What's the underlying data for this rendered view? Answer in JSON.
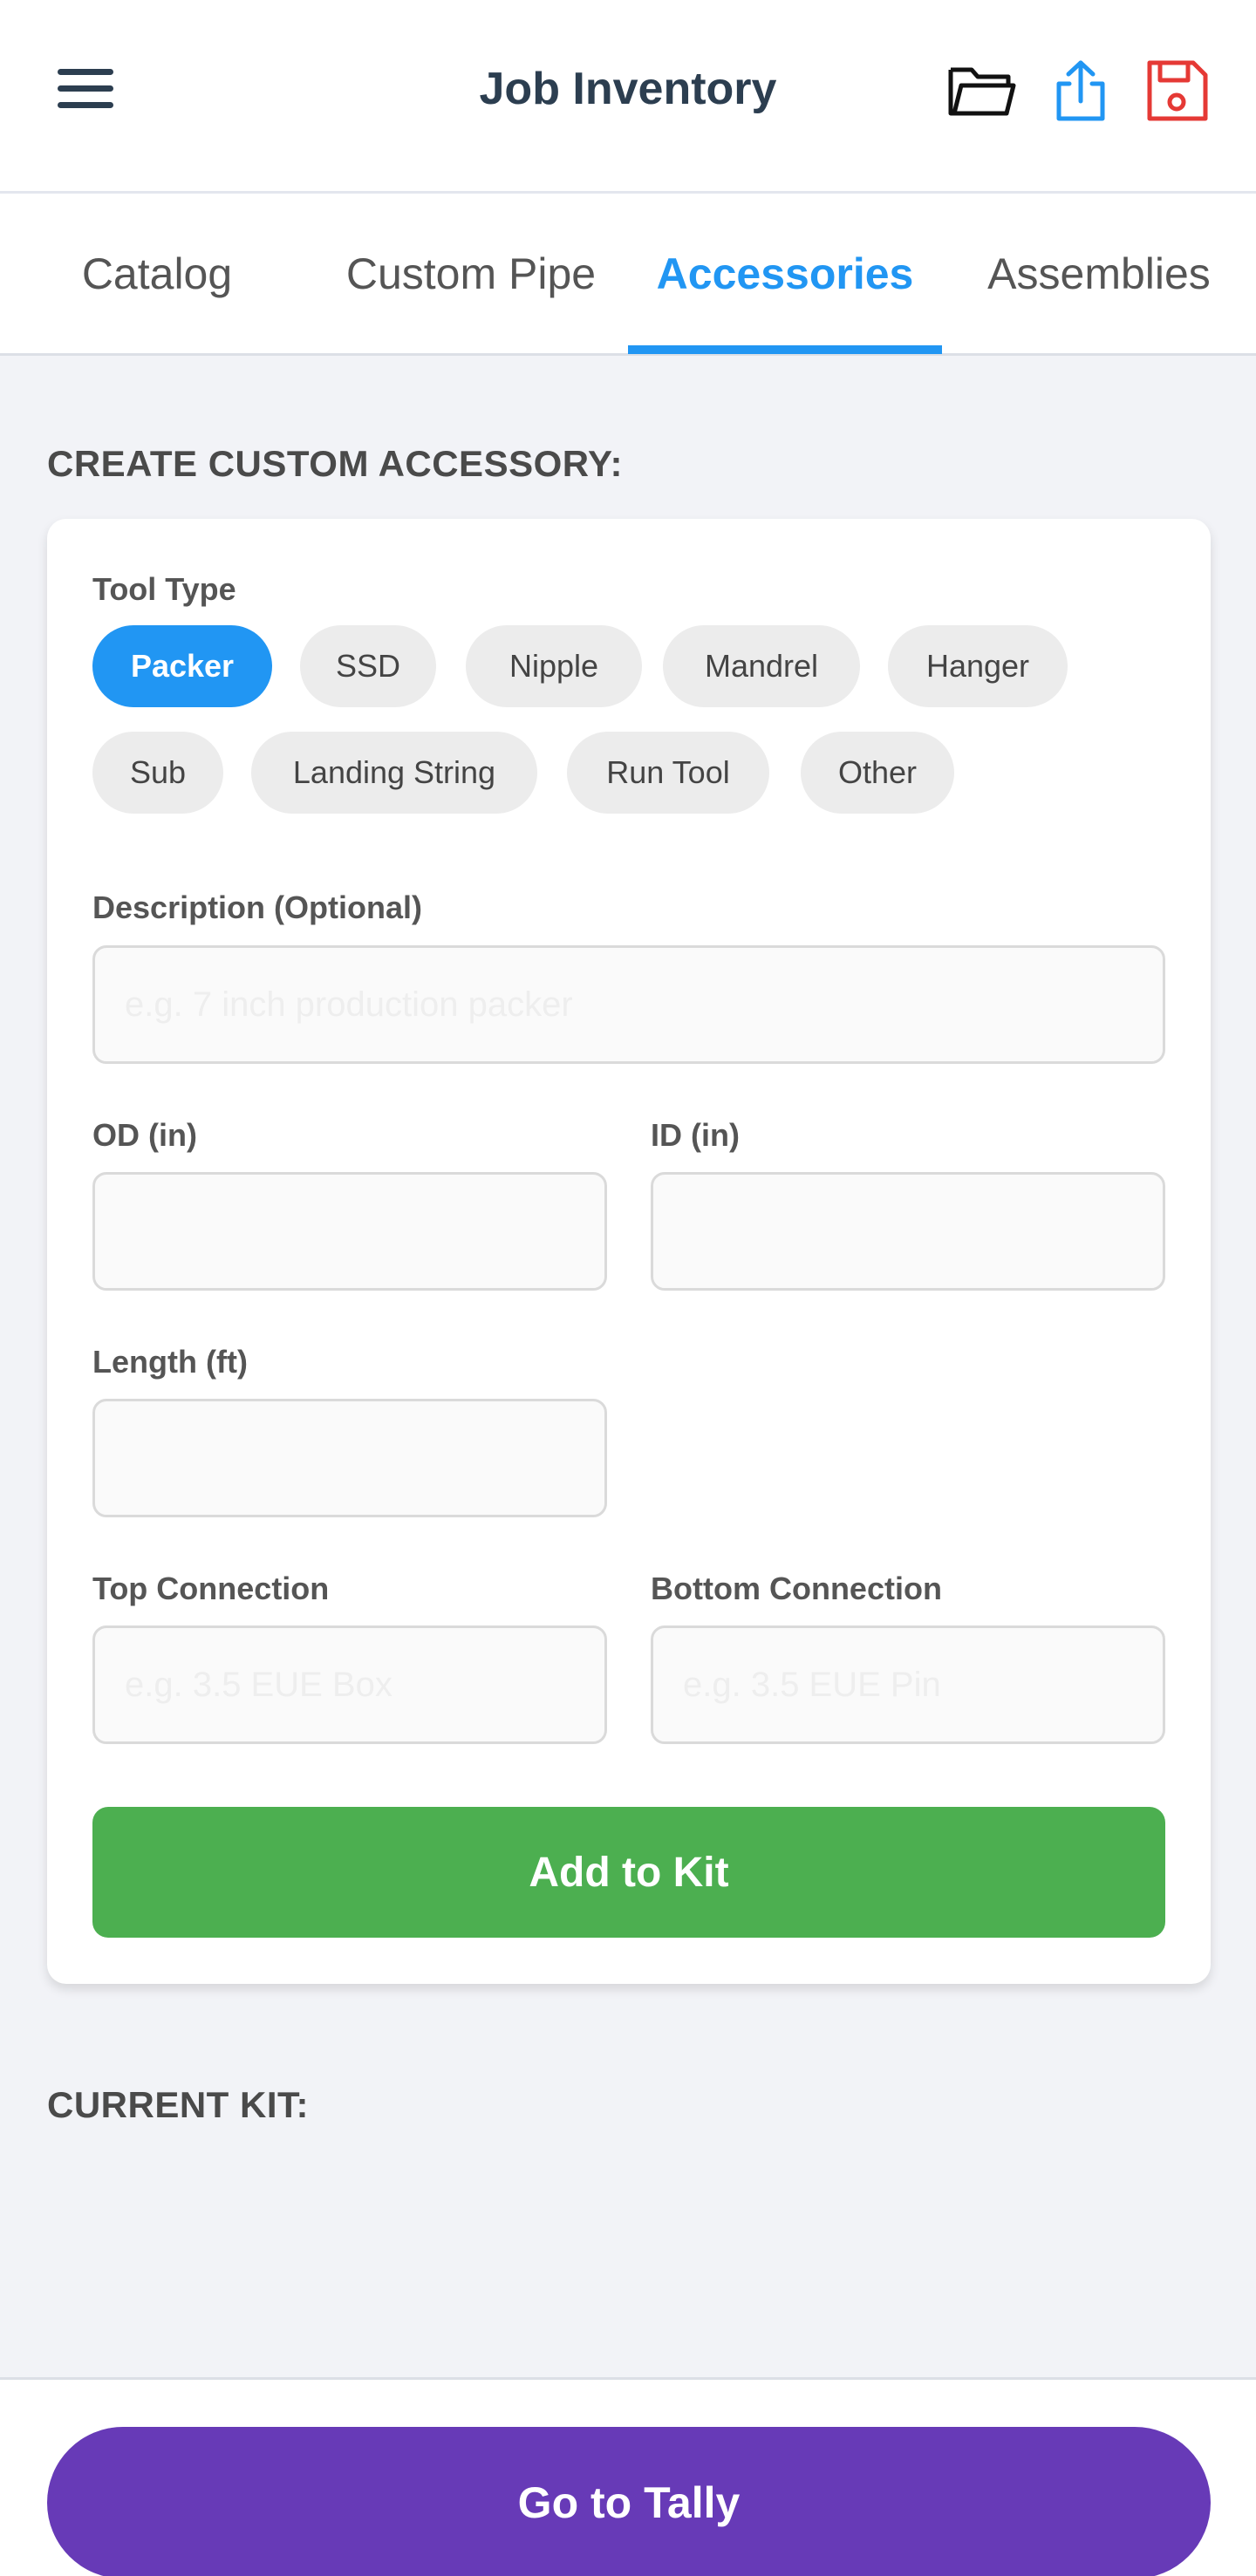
{
  "header": {
    "title": "Job Inventory",
    "icons": {
      "menu": "hamburger-menu-icon",
      "open": "folder-open-icon",
      "share": "share-icon",
      "save": "floppy-save-icon"
    }
  },
  "tabs": [
    {
      "label": "Catalog",
      "active": false
    },
    {
      "label": "Custom Pipe",
      "active": false
    },
    {
      "label": "Accessories",
      "active": true
    },
    {
      "label": "Assemblies",
      "active": false
    }
  ],
  "create_section": {
    "title": "CREATE CUSTOM ACCESSORY:",
    "tool_type": {
      "label": "Tool Type",
      "selected": "Packer",
      "options": [
        "Packer",
        "SSD",
        "Nipple",
        "Mandrel",
        "Hanger",
        "Sub",
        "Landing String",
        "Run Tool",
        "Other"
      ]
    },
    "description": {
      "label": "Description (Optional)",
      "placeholder": "e.g. 7 inch production packer",
      "value": ""
    },
    "od": {
      "label": "OD (in)",
      "value": ""
    },
    "id": {
      "label": "ID (in)",
      "value": ""
    },
    "length": {
      "label": "Length (ft)",
      "value": ""
    },
    "top_connection": {
      "label": "Top Connection",
      "placeholder": "e.g. 3.5 EUE Box",
      "value": ""
    },
    "bottom_connection": {
      "label": "Bottom Connection",
      "placeholder": "e.g. 3.5 EUE Pin",
      "value": ""
    },
    "add_button": "Add to Kit"
  },
  "current_kit": {
    "title": "CURRENT KIT:",
    "items": []
  },
  "footer": {
    "button": "Go to Tally"
  },
  "colors": {
    "primary": "#2196f3",
    "success": "#4caf50",
    "purple": "#673ab7",
    "heading": "#2c3e50",
    "danger": "#e53935"
  }
}
